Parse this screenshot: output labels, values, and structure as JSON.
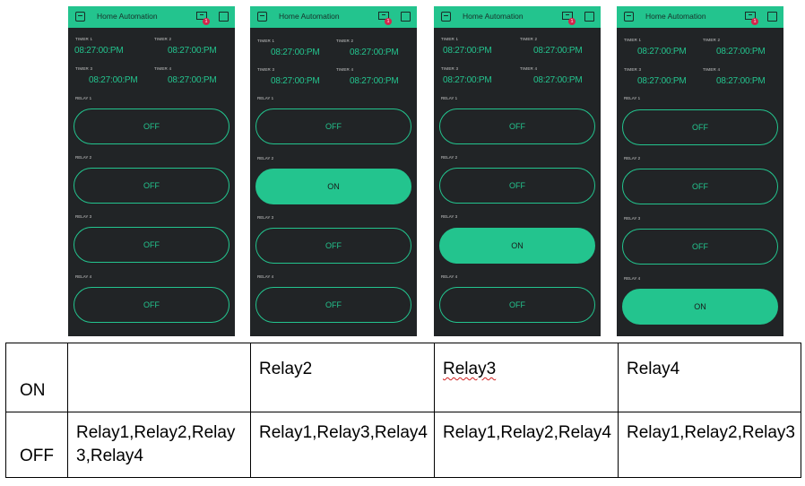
{
  "app": {
    "title": "Home Automation",
    "notification_count": "1",
    "accent_color": "#23c48e",
    "background_color": "#212426"
  },
  "phones": [
    {
      "timers": [
        {
          "label": "TIMER 1",
          "time": "08:27:00:PM"
        },
        {
          "label": "TIMER 2",
          "time": "08:27:00:PM"
        },
        {
          "label": "TIMER 3",
          "time": "08:27:00:PM"
        },
        {
          "label": "TIMER 4",
          "time": "08:27:00:PM"
        }
      ],
      "relays": [
        {
          "label": "RELAY 1",
          "state": "OFF"
        },
        {
          "label": "RELAY 2",
          "state": "OFF"
        },
        {
          "label": "RELAY 3",
          "state": "OFF"
        },
        {
          "label": "RELAY 4",
          "state": "OFF"
        }
      ]
    },
    {
      "timers": [
        {
          "label": "TIMER 1",
          "time": "08:27:00:PM"
        },
        {
          "label": "TIMER 2",
          "time": "08:27:00:PM"
        },
        {
          "label": "TIMER 3",
          "time": "08:27:00:PM"
        },
        {
          "label": "TIMER 4",
          "time": "08:27:00:PM"
        }
      ],
      "relays": [
        {
          "label": "RELAY 1",
          "state": "OFF"
        },
        {
          "label": "RELAY 2",
          "state": "ON"
        },
        {
          "label": "RELAY 3",
          "state": "OFF"
        },
        {
          "label": "RELAY 4",
          "state": "OFF"
        }
      ]
    },
    {
      "timers": [
        {
          "label": "TIMER 1",
          "time": "08:27:00:PM"
        },
        {
          "label": "TIMER 2",
          "time": "08:27:00:PM"
        },
        {
          "label": "TIMER 3",
          "time": "08:27:00:PM"
        },
        {
          "label": "TIMER 4",
          "time": "08:27:00:PM"
        }
      ],
      "relays": [
        {
          "label": "RELAY 1",
          "state": "OFF"
        },
        {
          "label": "RELAY 2",
          "state": "OFF"
        },
        {
          "label": "RELAY 3",
          "state": "ON"
        },
        {
          "label": "RELAY 4",
          "state": "OFF"
        }
      ]
    },
    {
      "timers": [
        {
          "label": "TIMER 1",
          "time": "08:27:00:PM"
        },
        {
          "label": "TIMER 2",
          "time": "08:27:00:PM"
        },
        {
          "label": "TIMER 3",
          "time": "08:27:00:PM"
        },
        {
          "label": "TIMER 4",
          "time": "08:27:00:PM"
        }
      ],
      "relays": [
        {
          "label": "RELAY 1",
          "state": "OFF"
        },
        {
          "label": "RELAY 2",
          "state": "OFF"
        },
        {
          "label": "RELAY 3",
          "state": "OFF"
        },
        {
          "label": "RELAY 4",
          "state": "ON"
        }
      ]
    }
  ],
  "table": {
    "rows": [
      {
        "label": "ON",
        "cells": [
          "",
          "Relay2",
          "Relay3",
          "Relay4"
        ]
      },
      {
        "label": "OFF",
        "cells": [
          "Relay1,Relay2,Relay3,Relay4",
          "Relay1,Relay3,Relay4",
          "Relay1,Relay2,Relay4",
          "Relay1,Relay2,Relay3"
        ]
      }
    ]
  }
}
